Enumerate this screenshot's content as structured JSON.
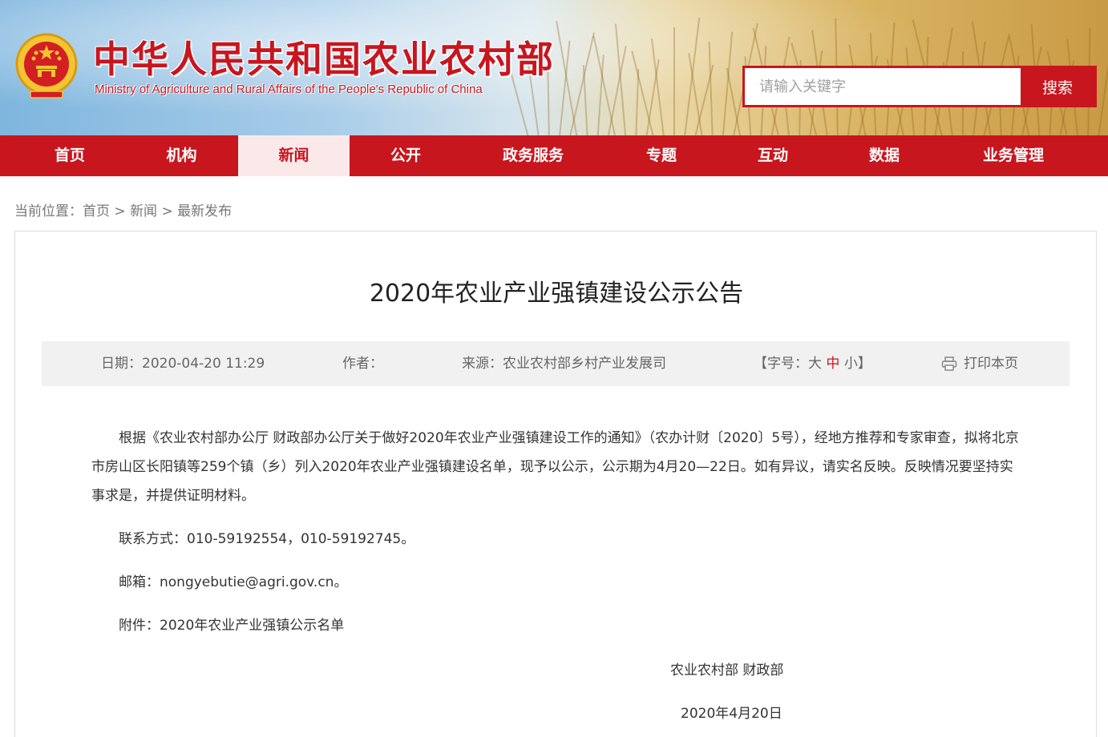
{
  "header": {
    "title": "中华人民共和国农业农村部",
    "subtitle": "Ministry of Agriculture and Rural Affairs of the People's Republic of China",
    "search": {
      "placeholder": "请输入关键字",
      "button_label": "搜索"
    },
    "colors": {
      "brand_red": "#c8161e",
      "emblem_gold": "#f3c531"
    }
  },
  "nav": {
    "items": [
      {
        "label": "首页"
      },
      {
        "label": "机构"
      },
      {
        "label": "新闻",
        "active": true
      },
      {
        "label": "公开"
      },
      {
        "label": "政务服务"
      },
      {
        "label": "专题"
      },
      {
        "label": "互动"
      },
      {
        "label": "数据"
      },
      {
        "label": "业务管理"
      }
    ]
  },
  "breadcrumb": {
    "prefix": "当前位置：",
    "items": [
      "首页",
      "新闻",
      "最新发布"
    ],
    "separator": ">"
  },
  "article": {
    "title": "2020年农业产业强镇建设公示公告",
    "meta": {
      "date": "日期：2020-04-20 11:29",
      "author": "作者：",
      "source": "来源：农业农村部乡村产业发展司",
      "font_size_prefix": "【字号：",
      "font_large": "大",
      "font_medium": "中",
      "font_small": "小",
      "font_size_suffix": "】",
      "print_label": "打印本页",
      "print_icon": "printer-icon"
    },
    "paragraphs": [
      "根据《农业农村部办公厅 财政部办公厅关于做好2020年农业产业强镇建设工作的通知》（农办计财〔2020〕5号），经地方推荐和专家审查，拟将北京市房山区长阳镇等259个镇（乡）列入2020年农业产业强镇建设名单，现予以公示，公示期为4月20—22日。如有异议，请实名反映。反映情况要坚持实事求是，并提供证明材料。",
      "联系方式：010-59192554，010-59192745。",
      "邮箱：nongyebutie@agri.gov.cn。",
      "附件：2020年农业产业强镇公示名单"
    ],
    "signoff_org": "农业农村部 财政部",
    "signoff_date": "2020年4月20日"
  }
}
